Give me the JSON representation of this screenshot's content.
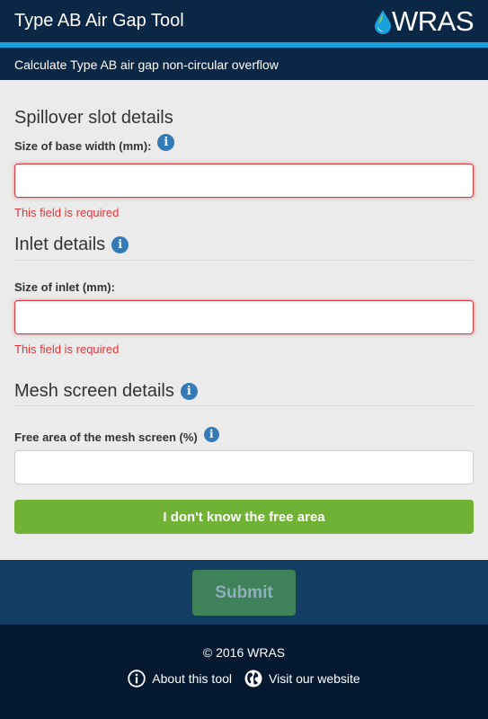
{
  "header": {
    "title": "Type AB Air Gap Tool",
    "logo_text": "WRAS",
    "subtitle": "Calculate Type AB air gap non-circular overflow"
  },
  "spillover": {
    "section_title": "Spillover slot details",
    "field_label": "Size of base width (mm):",
    "value": "",
    "error": "This field is required"
  },
  "inlet": {
    "section_title": "Inlet details",
    "field_label": "Size of inlet (mm):",
    "value": "",
    "error": "This field is required"
  },
  "mesh": {
    "section_title": "Mesh screen details",
    "field_label": "Free area of the mesh screen (%)",
    "value": "",
    "unknown_button": "I don't know the free area"
  },
  "actions": {
    "submit": "Submit"
  },
  "footer": {
    "copyright": "© 2016 WRAS",
    "about_link": "About this tool",
    "website_link": "Visit our website"
  },
  "icons": {
    "info": "info-icon",
    "globe": "globe-icon",
    "water_drop": "water-drop-icon"
  },
  "colors": {
    "header_bg": "#0b2746",
    "accent_stripe": "#18a0de",
    "error": "#e0373a",
    "green_button": "#70b235",
    "submit_bar": "#133d63",
    "submit_button": "#3f8158",
    "footer_bg": "#04182f",
    "info_icon": "#337ab7"
  }
}
